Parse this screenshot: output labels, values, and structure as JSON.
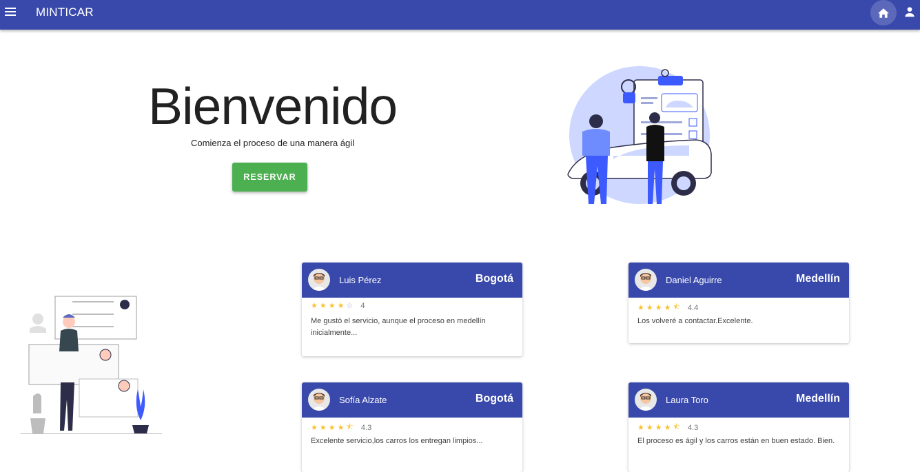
{
  "header": {
    "brand": "MINTICAR",
    "menu_icon": "menu-icon",
    "home_icon": "home-icon",
    "user_icon": "account-icon",
    "color": "#3949ab"
  },
  "hero": {
    "title": "Bienvenido",
    "subtitle": "Comienza el proceso de una manera ágil",
    "button_label": "RESERVAR",
    "button_color": "#4caf50"
  },
  "reviews": [
    {
      "name": "Luis Pérez",
      "city": "Bogotá",
      "rating": 4,
      "rating_label": "4",
      "text": "Me gustó el servicio, aunque el proceso en medellín inicialmente..."
    },
    {
      "name": "Daniel Aguirre",
      "city": "Medellín",
      "rating": 4.4,
      "rating_label": "4.4",
      "text": "Los volveré a contactar.Excelente."
    },
    {
      "name": "Sofía Alzate",
      "city": "Bogotá",
      "rating": 4.3,
      "rating_label": "4.3",
      "text": "Excelente servicio,los carros los entregan limpios..."
    },
    {
      "name": "Laura Toro",
      "city": "Medellín",
      "rating": 4.3,
      "rating_label": "4.3",
      "text": "El proceso es ágil y los carros están en buen estado. Bien."
    }
  ]
}
